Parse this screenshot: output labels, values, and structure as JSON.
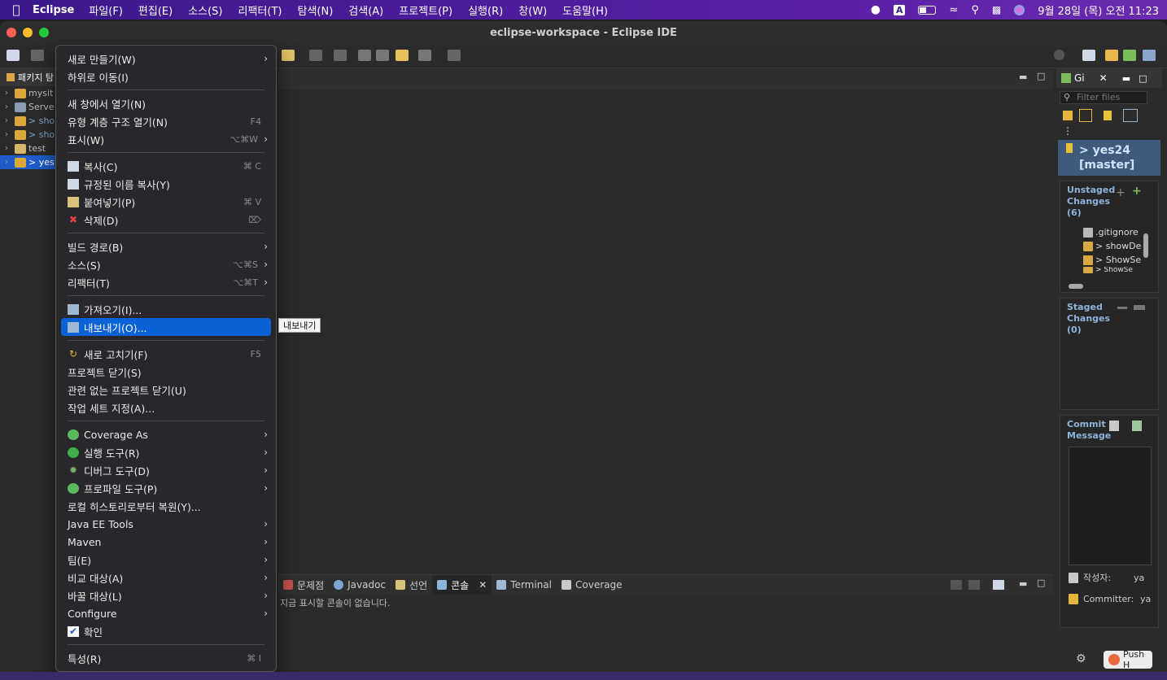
{
  "menubar": {
    "app_name": "Eclipse",
    "items": [
      "파일(F)",
      "편집(E)",
      "소스(S)",
      "리팩터(T)",
      "탐색(N)",
      "검색(A)",
      "프로젝트(P)",
      "실행(R)",
      "창(W)",
      "도움말(H)"
    ],
    "input_indicator": "A",
    "datetime": "9월 28일 (목) 오전 11:23"
  },
  "window": {
    "title": "eclipse-workspace - Eclipse IDE"
  },
  "package_explorer": {
    "tab_label": "패키지 탐",
    "items": [
      {
        "label": "mysit",
        "selected": false
      },
      {
        "label": "Serve",
        "selected": false
      },
      {
        "label": "> sho",
        "selected": false
      },
      {
        "label": "> sho",
        "selected": false
      },
      {
        "label": "test",
        "selected": false
      },
      {
        "label": "> yes",
        "selected": true
      }
    ]
  },
  "context_menu": {
    "groups": [
      [
        {
          "label": "새로 만들기(W)",
          "shortcut": "",
          "submenu": true,
          "icon": ""
        },
        {
          "label": "하위로 이동(I)",
          "shortcut": "",
          "submenu": false,
          "icon": ""
        }
      ],
      [
        {
          "label": "새 창에서 열기(N)",
          "shortcut": "",
          "submenu": false,
          "icon": ""
        },
        {
          "label": "유형 계층 구조 열기(N)",
          "shortcut": "F4",
          "submenu": false,
          "icon": ""
        },
        {
          "label": "표시(W)",
          "shortcut": "⌥⌘W",
          "submenu": true,
          "icon": ""
        }
      ],
      [
        {
          "label": "복사(C)",
          "shortcut": "⌘ C",
          "submenu": false,
          "icon": "copy-icon"
        },
        {
          "label": "규정된 이름 복사(Y)",
          "shortcut": "",
          "submenu": false,
          "icon": "copy-qualified-icon"
        },
        {
          "label": "붙여넣기(P)",
          "shortcut": "⌘ V",
          "submenu": false,
          "icon": "paste-icon"
        },
        {
          "label": "삭제(D)",
          "shortcut": "⌦",
          "submenu": false,
          "icon": "delete-icon"
        }
      ],
      [
        {
          "label": "빌드 경로(B)",
          "shortcut": "",
          "submenu": true,
          "icon": ""
        },
        {
          "label": "소스(S)",
          "shortcut": "⌥⌘S",
          "submenu": true,
          "icon": ""
        },
        {
          "label": "리팩터(T)",
          "shortcut": "⌥⌘T",
          "submenu": true,
          "icon": ""
        }
      ],
      [
        {
          "label": "가져오기(I)...",
          "shortcut": "",
          "submenu": false,
          "icon": "import-icon"
        },
        {
          "label": "내보내기(O)...",
          "shortcut": "",
          "submenu": false,
          "icon": "export-icon",
          "highlighted": true
        }
      ],
      [
        {
          "label": "새로 고치기(F)",
          "shortcut": "F5",
          "submenu": false,
          "icon": "refresh-icon"
        },
        {
          "label": "프로젝트 닫기(S)",
          "shortcut": "",
          "submenu": false,
          "icon": ""
        },
        {
          "label": "관련 없는 프로젝트 닫기(U)",
          "shortcut": "",
          "submenu": false,
          "icon": ""
        },
        {
          "label": "작업 세트 지정(A)...",
          "shortcut": "",
          "submenu": false,
          "icon": ""
        }
      ],
      [
        {
          "label": "Coverage As",
          "shortcut": "",
          "submenu": true,
          "icon": "coverage-icon"
        },
        {
          "label": "실행 도구(R)",
          "shortcut": "",
          "submenu": true,
          "icon": "run-icon"
        },
        {
          "label": "디버그 도구(D)",
          "shortcut": "",
          "submenu": true,
          "icon": "debug-icon"
        },
        {
          "label": "프로파일 도구(P)",
          "shortcut": "",
          "submenu": true,
          "icon": "profile-icon"
        },
        {
          "label": "로컬 히스토리로부터 복원(Y)...",
          "shortcut": "",
          "submenu": false,
          "icon": ""
        },
        {
          "label": "Java EE Tools",
          "shortcut": "",
          "submenu": true,
          "icon": ""
        },
        {
          "label": "Maven",
          "shortcut": "",
          "submenu": true,
          "icon": ""
        },
        {
          "label": "팀(E)",
          "shortcut": "",
          "submenu": true,
          "icon": ""
        },
        {
          "label": "비교 대상(A)",
          "shortcut": "",
          "submenu": true,
          "icon": ""
        },
        {
          "label": "바꿀 대상(L)",
          "shortcut": "",
          "submenu": true,
          "icon": ""
        },
        {
          "label": "Configure",
          "shortcut": "",
          "submenu": true,
          "icon": ""
        },
        {
          "label": "확인",
          "shortcut": "",
          "submenu": false,
          "icon": "check-icon"
        }
      ],
      [
        {
          "label": "특성(R)",
          "shortcut": "⌘ I",
          "submenu": false,
          "icon": ""
        }
      ]
    ]
  },
  "tooltip": "내보내기",
  "console": {
    "tabs": [
      "문제점",
      "Javadoc",
      "선언",
      "콘솔",
      "Terminal",
      "Coverage"
    ],
    "active_tab": "콘솔",
    "message": "지금 표시할 콘솔이 없습니다."
  },
  "git_staging": {
    "tab_label": "Gi",
    "filter_placeholder": "Filter files",
    "repo_line1": "> yes24",
    "repo_line2": "[master]",
    "unstaged_title": "Unstaged Changes (6)",
    "unstaged_files": [
      ".gitignore",
      "> showDe",
      "> ShowSe",
      "> ShowSe"
    ],
    "staged_title": "Staged Changes (0)",
    "commit_title": "Commit Message",
    "author_label": "작성자:",
    "author_value": "ya",
    "committer_label": "Committer:",
    "committer_value": "ya",
    "push_label": "Push H"
  },
  "statusbar": {
    "selection": "yes24"
  },
  "colors": {
    "menu_highlight": "#0a62d6",
    "git_repo_bg": "#3f5a7a",
    "selection": "#1f5bc9"
  }
}
